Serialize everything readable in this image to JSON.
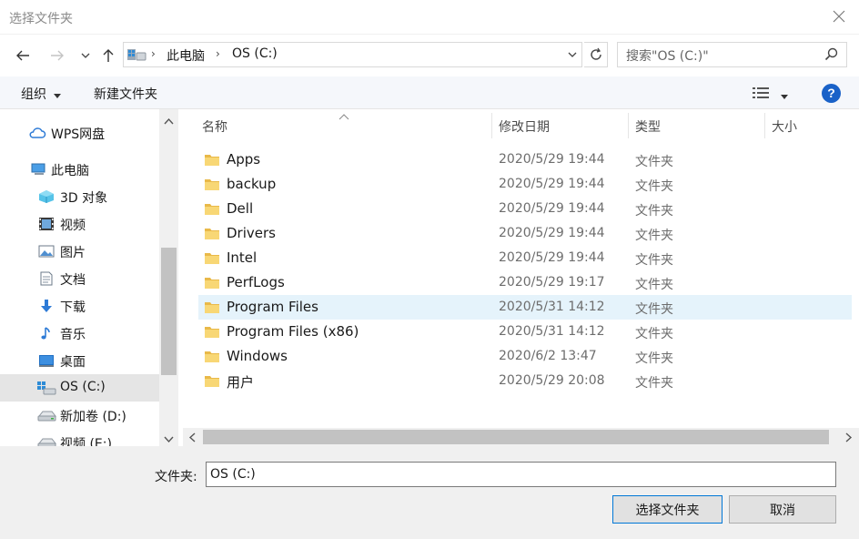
{
  "window": {
    "title": "选择文件夹"
  },
  "address": {
    "crumbs": [
      "此电脑",
      "OS (C:)"
    ]
  },
  "search": {
    "placeholder": "搜索\"OS (C:)\""
  },
  "toolbar": {
    "organize_label": "组织",
    "new_folder_label": "新建文件夹",
    "help_label": "?"
  },
  "sidebar": {
    "items": [
      {
        "label": "WPS网盘",
        "icon": "cloud-icon"
      },
      {
        "label": "此电脑",
        "icon": "computer-icon"
      },
      {
        "label": "3D 对象",
        "icon": "3d-objects-icon"
      },
      {
        "label": "视频",
        "icon": "video-icon"
      },
      {
        "label": "图片",
        "icon": "pictures-icon"
      },
      {
        "label": "文档",
        "icon": "document-icon"
      },
      {
        "label": "下载",
        "icon": "download-icon"
      },
      {
        "label": "音乐",
        "icon": "music-icon"
      },
      {
        "label": "桌面",
        "icon": "desktop-icon"
      },
      {
        "label": "OS (C:)",
        "icon": "windows-drive-icon",
        "selected": true
      },
      {
        "label": "新加卷 (D:)",
        "icon": "drive-icon"
      },
      {
        "label": "视频 (E:)",
        "icon": "drive-icon"
      }
    ]
  },
  "columns": {
    "name": "名称",
    "date": "修改日期",
    "type": "类型",
    "size": "大小"
  },
  "files": [
    {
      "name": "Apps",
      "date": "2020/5/29 19:44",
      "type": "文件夹"
    },
    {
      "name": "backup",
      "date": "2020/5/29 19:44",
      "type": "文件夹"
    },
    {
      "name": "Dell",
      "date": "2020/5/29 19:44",
      "type": "文件夹"
    },
    {
      "name": "Drivers",
      "date": "2020/5/29 19:44",
      "type": "文件夹"
    },
    {
      "name": "Intel",
      "date": "2020/5/29 19:44",
      "type": "文件夹"
    },
    {
      "name": "PerfLogs",
      "date": "2020/5/29 19:17",
      "type": "文件夹"
    },
    {
      "name": "Program Files",
      "date": "2020/5/31 14:12",
      "type": "文件夹",
      "selected": true
    },
    {
      "name": "Program Files (x86)",
      "date": "2020/5/31 14:12",
      "type": "文件夹"
    },
    {
      "name": "Windows",
      "date": "2020/6/2 13:47",
      "type": "文件夹"
    },
    {
      "name": "用户",
      "date": "2020/5/29 20:08",
      "type": "文件夹"
    }
  ],
  "footer": {
    "folder_label": "文件夹:",
    "folder_value": "OS (C:)",
    "select_label": "选择文件夹",
    "cancel_label": "取消"
  },
  "colors": {
    "accent": "#0078d7",
    "folder": "#f8d775",
    "selected_row": "#e5f3fb",
    "help": "#1a62c8"
  }
}
